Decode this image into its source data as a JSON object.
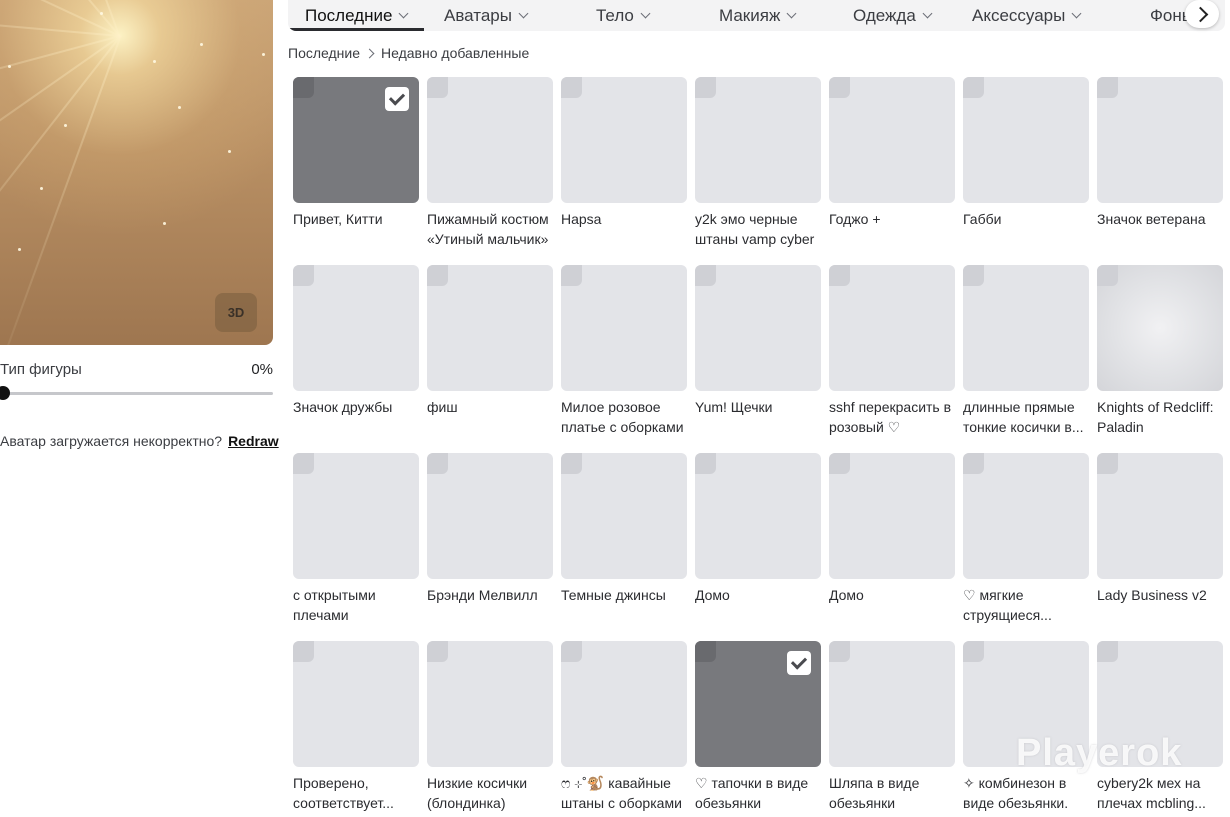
{
  "avatar": {
    "view_3d_label": "3D",
    "shape_type_label": "Тип фигуры",
    "shape_type_value": "0%",
    "slider_fraction": 0,
    "reload_question": "Аватар загружается некорректно?",
    "reload_link": "Redraw"
  },
  "tabs": [
    {
      "label": "Последние",
      "active": true,
      "dropdown": true
    },
    {
      "label": "Аватары",
      "active": false,
      "dropdown": true
    },
    {
      "label": "Тело",
      "active": false,
      "dropdown": true
    },
    {
      "label": "Макияж",
      "active": false,
      "dropdown": true
    },
    {
      "label": "Одежда",
      "active": false,
      "dropdown": true
    },
    {
      "label": "Аксессуары",
      "active": false,
      "dropdown": true
    },
    {
      "label": "Фоны",
      "active": false,
      "dropdown": false
    }
  ],
  "breadcrumb": {
    "root": "Последние",
    "current": "Недавно добавленные"
  },
  "items": [
    {
      "name": "Привет, Китти",
      "selected": true
    },
    {
      "name": "Пижамный костюм «Утиный мальчик»"
    },
    {
      "name": "Hapsa"
    },
    {
      "name": "y2k эмо черные штаны vamp cyber"
    },
    {
      "name": "Годжо +"
    },
    {
      "name": "Габби"
    },
    {
      "name": "Значок ветерана"
    },
    {
      "name": "Значок дружбы"
    },
    {
      "name": "фиш"
    },
    {
      "name": "Милое розовое платье с оборками"
    },
    {
      "name": "Yum! Щечки"
    },
    {
      "name": "sshf перекрасить в розовый ♡"
    },
    {
      "name": "длинные прямые тонкие косички в..."
    },
    {
      "name": "Knights of Redcliff: Paladin",
      "special": true
    },
    {
      "name": "с открытыми плечами"
    },
    {
      "name": "Брэнди Мелвилл"
    },
    {
      "name": "Темные джинсы"
    },
    {
      "name": "Домо"
    },
    {
      "name": "Домо"
    },
    {
      "name": "♡ мягкие струящиеся..."
    },
    {
      "name": "Lady Business v2"
    },
    {
      "name": "Проверено, соответствует..."
    },
    {
      "name": "Низкие косички (блондинка)"
    },
    {
      "name": "ෆ ⊹˚🐒 кавайные штаны с оборками"
    },
    {
      "name": "♡ тапочки в виде обезьянки",
      "selected": true
    },
    {
      "name": "Шляпа в виде обезьянки"
    },
    {
      "name": "✧ комбинезон в виде обезьянки."
    },
    {
      "name": "cybery2k мех на плечах mcbling..."
    }
  ],
  "watermark": "Playerok"
}
